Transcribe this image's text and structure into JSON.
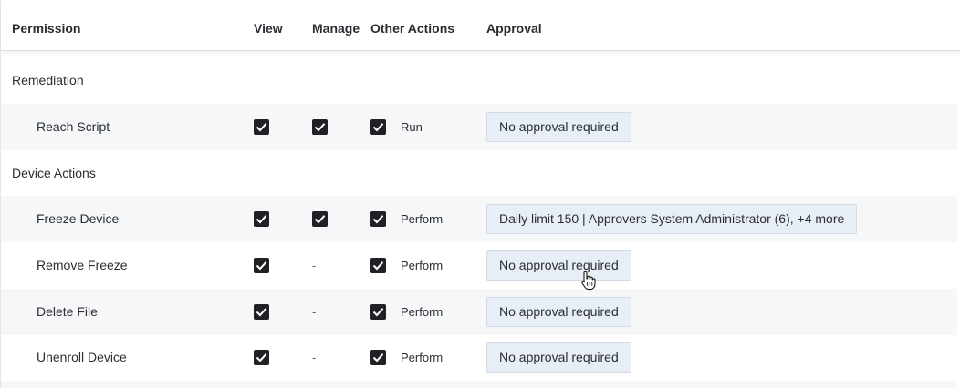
{
  "columns": {
    "permission": "Permission",
    "view": "View",
    "manage": "Manage",
    "other_actions": "Other Actions",
    "approval": "Approval"
  },
  "groups": [
    {
      "label": "Remediation",
      "rows": [
        {
          "name": "Reach Script",
          "view": true,
          "manage": true,
          "manage_text": "",
          "other": true,
          "action": "Run",
          "approval": "No approval required"
        }
      ]
    },
    {
      "label": "Device Actions",
      "rows": [
        {
          "name": "Freeze Device",
          "view": true,
          "manage": true,
          "manage_text": "",
          "other": true,
          "action": "Perform",
          "approval": "Daily limit 150 | Approvers System Administrator (6), +4 more"
        },
        {
          "name": "Remove Freeze",
          "view": true,
          "manage": false,
          "manage_text": "-",
          "other": true,
          "action": "Perform",
          "approval": "No approval required"
        },
        {
          "name": "Delete File",
          "view": true,
          "manage": false,
          "manage_text": "-",
          "other": true,
          "action": "Perform",
          "approval": "No approval required"
        },
        {
          "name": "Unenroll Device",
          "view": true,
          "manage": false,
          "manage_text": "-",
          "other": true,
          "action": "Perform",
          "approval": "No approval required"
        }
      ]
    }
  ],
  "colors": {
    "checkbox": "#1f2124",
    "approval_bg": "#e8eef6",
    "row_alt": "#f6f7f8"
  }
}
